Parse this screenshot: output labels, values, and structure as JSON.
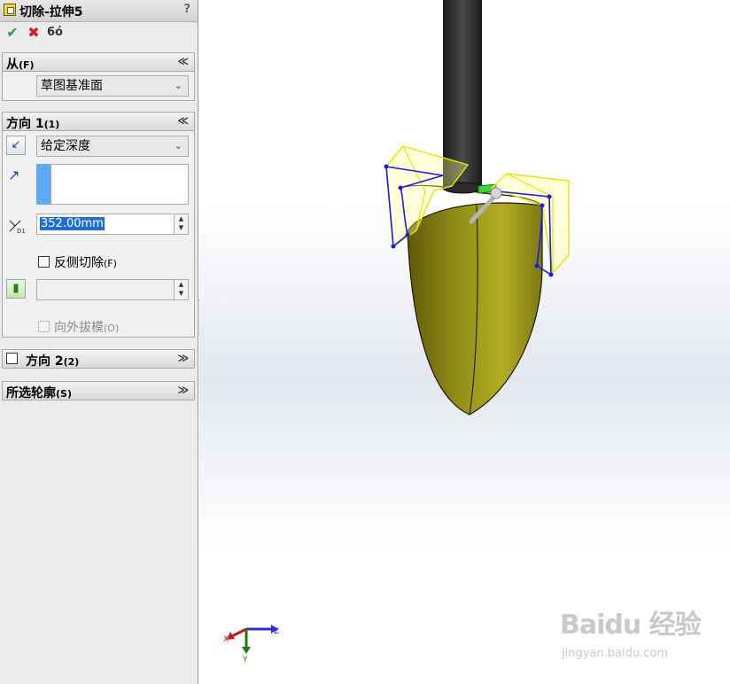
{
  "panel": {
    "title": "切除-拉伸5",
    "help": "?",
    "actions": {
      "ok": "✔",
      "cancel": "✖",
      "preview": "6ó"
    }
  },
  "from_group": {
    "title": "从",
    "hotkey": "(F)",
    "chevron": "≪",
    "start_condition": "草图基准面"
  },
  "direction1_group": {
    "title": "方向 1",
    "hotkey": "(1)",
    "chevron": "≪",
    "end_condition": "给定深度",
    "depth": "352.00mm",
    "depth_icon_label": "D1",
    "flip_side_label": "反侧切除",
    "flip_side_hotkey": "(F)",
    "draft_outward_label": "向外拔模",
    "draft_outward_hotkey": "(O)"
  },
  "direction2_group": {
    "title": "方向 2",
    "hotkey": "(2)",
    "chevron": "≫"
  },
  "contours_group": {
    "title": "所选轮廓",
    "hotkey": "(S)",
    "chevron": "≫"
  },
  "triad": {
    "x": "X",
    "y": "Y",
    "z": "Z"
  },
  "watermark": {
    "logo": "Baidu 经验",
    "url": "jingyan.baidu.com"
  },
  "colors": {
    "blade": "#8f8c16",
    "handle": "#2a2a2a",
    "sketch": "#1c1ce0",
    "preview": "#f2f200"
  }
}
